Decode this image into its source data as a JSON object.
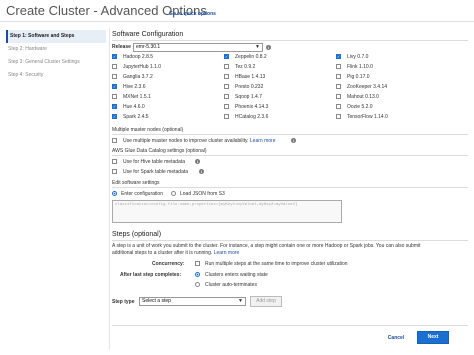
{
  "header": {
    "title": "Create Cluster - Advanced Options",
    "quick_options_link": "Go to quick options"
  },
  "steps_nav": [
    {
      "label": "Step 1: Software and Steps",
      "active": true
    },
    {
      "label": "Step 2: Hardware",
      "active": false
    },
    {
      "label": "Step 3: General Cluster Settings",
      "active": false
    },
    {
      "label": "Step 4: Security",
      "active": false
    }
  ],
  "software": {
    "heading": "Software Configuration",
    "release_label": "Release",
    "release_value": "emr-5.30.1",
    "applications": [
      [
        {
          "label": "Hadoop 2.8.5",
          "checked": true
        },
        {
          "label": "JupyterHub 1.1.0",
          "checked": false
        },
        {
          "label": "Ganglia 3.7.2",
          "checked": false
        },
        {
          "label": "Hive 2.3.6",
          "checked": true
        },
        {
          "label": "MXNet 1.5.1",
          "checked": false
        },
        {
          "label": "Hue 4.6.0",
          "checked": true
        },
        {
          "label": "Spark 2.4.5",
          "checked": true
        }
      ],
      [
        {
          "label": "Zeppelin 0.8.2",
          "checked": true
        },
        {
          "label": "Tez 0.9.2",
          "checked": false
        },
        {
          "label": "HBase 1.4.13",
          "checked": false
        },
        {
          "label": "Presto 0.232",
          "checked": false
        },
        {
          "label": "Sqoop 1.4.7",
          "checked": false
        },
        {
          "label": "Phoenix 4.14.3",
          "checked": false
        },
        {
          "label": "HCatalog 2.3.6",
          "checked": false
        }
      ],
      [
        {
          "label": "Livy 0.7.0",
          "checked": true
        },
        {
          "label": "Flink 1.10.0",
          "checked": false
        },
        {
          "label": "Pig 0.17.0",
          "checked": false
        },
        {
          "label": "ZooKeeper 3.4.14",
          "checked": false
        },
        {
          "label": "Mahout 0.13.0",
          "checked": false
        },
        {
          "label": "Oozie 5.2.0",
          "checked": false
        },
        {
          "label": "TensorFlow 1.14.0",
          "checked": false
        }
      ]
    ],
    "multi_master": {
      "heading": "Multiple master nodes (optional)",
      "option": "Use multiple master nodes to improve cluster availability.",
      "learn_more": "Learn more"
    },
    "glue": {
      "heading": "AWS Glue Data Catalog settings (optional)",
      "hive": "Use for Hive table metadata",
      "spark": "Use for Spark table metadata"
    },
    "edit_settings": {
      "heading": "Edit software settings",
      "enter_config": "Enter configuration",
      "load_json": "Load JSON from S3",
      "placeholder": "classification=config-file-name,properties=[myKey1=myValue1,myKey2=myValue2]"
    }
  },
  "steps": {
    "heading": "Steps (optional)",
    "description_line1": "A step is a unit of work you submit to the cluster. For instance, a step might contain one or more Hadoop or Spark jobs. You can also submit",
    "description_line2": "additional steps to a cluster after it is running.",
    "learn_more": "Learn more",
    "concurrency_label": "Concurrency:",
    "concurrency_option": "Run multiple steps at the same time to improve cluster utilization",
    "after_last_label": "After last step completes:",
    "after_last_options": [
      {
        "label": "Clusters enters waiting state",
        "selected": true
      },
      {
        "label": "Cluster auto-terminates",
        "selected": false
      }
    ],
    "step_type_label": "Step type",
    "step_type_value": "Select a step",
    "add_step": "Add step"
  },
  "footer": {
    "cancel": "Cancel",
    "next": "Next"
  },
  "colors": {
    "accent": "#1a6fd0",
    "link": "#1a4fa0"
  }
}
